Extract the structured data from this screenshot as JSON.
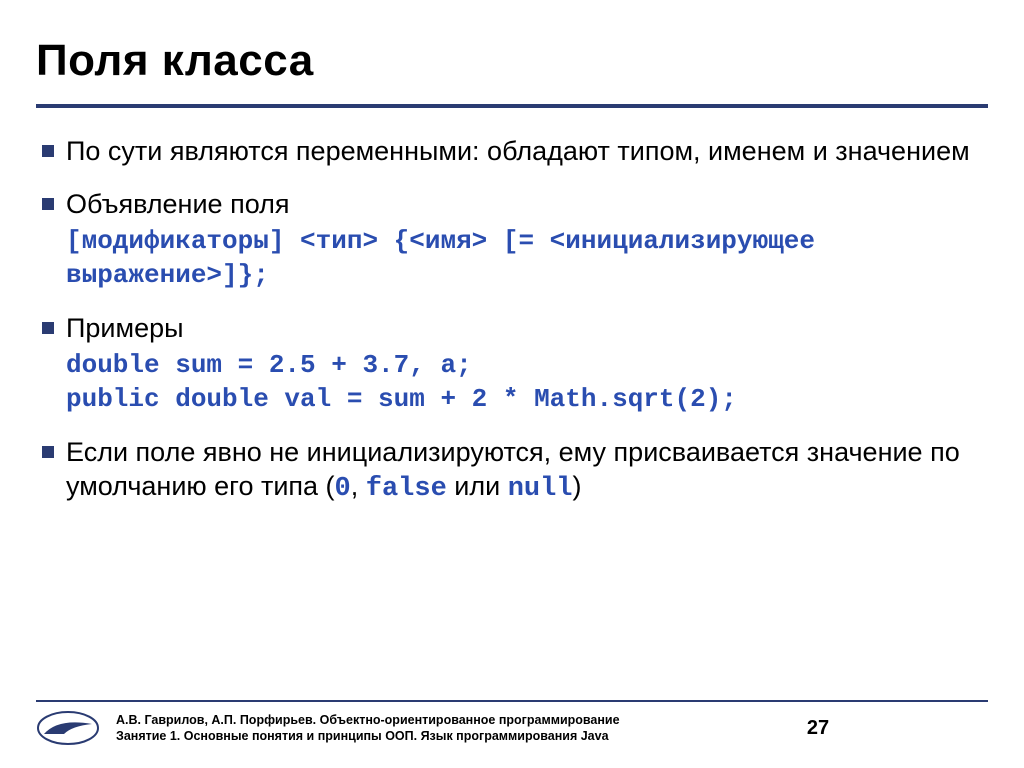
{
  "title": "Поля класса",
  "bullets": [
    {
      "text": "По сути являются переменными: обладают типом, именем и значением"
    },
    {
      "text": "Объявление поля",
      "code": "[модификаторы] <тип> {<имя> [=  <инициализирующее выражение>]};"
    },
    {
      "text": "Примеры",
      "code": "double sum = 2.5 + 3.7, a;\npublic double val = sum + 2 * Math.sqrt(2);"
    },
    {
      "segments": [
        {
          "t": "Если поле явно не инициализируются, ему присваивается значение по умолчанию его типа (",
          "c": false
        },
        {
          "t": "0",
          "c": true
        },
        {
          "t": ", ",
          "c": false
        },
        {
          "t": "false",
          "c": true
        },
        {
          "t": " или ",
          "c": false
        },
        {
          "t": "null",
          "c": true
        },
        {
          "t": ")",
          "c": false
        }
      ]
    }
  ],
  "footer": {
    "line1": "А.В. Гаврилов, А.П. Порфирьев. Объектно-ориентированное программирование",
    "line2": "Занятие 1. Основные понятия и принципы ООП. Язык программирования Java"
  },
  "page": "27"
}
